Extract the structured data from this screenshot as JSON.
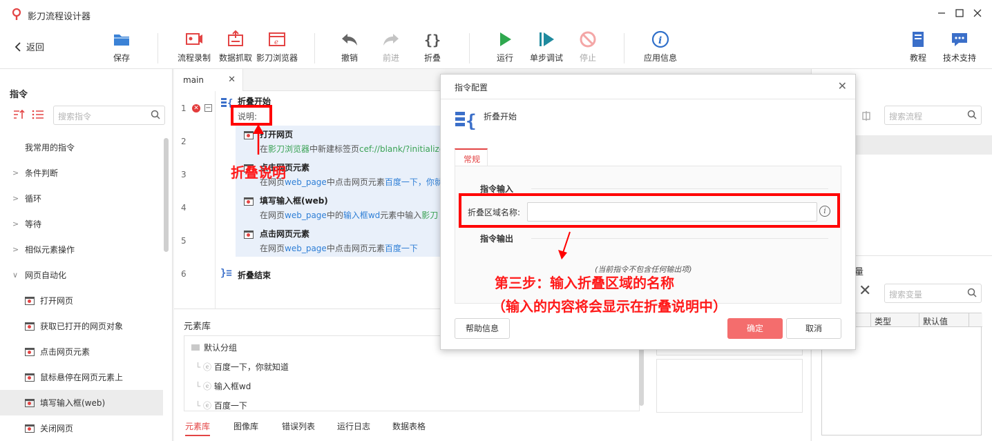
{
  "app": {
    "title": "影刀流程设计器"
  },
  "toolbar": {
    "back": "返回",
    "save": "保存",
    "record": "流程录制",
    "scrape": "数据抓取",
    "browser": "影刀浏览器",
    "undo": "撤销",
    "redo": "前进",
    "fold": "折叠",
    "run": "运行",
    "step_debug": "单步调试",
    "stop": "停止",
    "app_info": "应用信息",
    "tutorial": "教程",
    "support": "技术支持"
  },
  "left_panel": {
    "title": "指令",
    "search_placeholder": "搜索指令",
    "items": [
      {
        "label": "我常用的指令",
        "kind": "plain"
      },
      {
        "label": "条件判断",
        "kind": "group"
      },
      {
        "label": "循环",
        "kind": "group"
      },
      {
        "label": "等待",
        "kind": "group"
      },
      {
        "label": "相似元素操作",
        "kind": "group"
      },
      {
        "label": "网页自动化",
        "kind": "group-open"
      },
      {
        "label": "打开网页",
        "kind": "sub"
      },
      {
        "label": "获取已打开的网页对象",
        "kind": "sub"
      },
      {
        "label": "点击网页元素",
        "kind": "sub"
      },
      {
        "label": "鼠标悬停在网页元素上",
        "kind": "sub"
      },
      {
        "label": "填写输入框(web)",
        "kind": "sub-selected"
      },
      {
        "label": "关闭网页",
        "kind": "sub"
      }
    ]
  },
  "editor": {
    "tab": "main",
    "line_numbers": [
      "1",
      "2",
      "3",
      "4",
      "5",
      "6"
    ],
    "fold_start": "折叠开始",
    "note_label": "说明:",
    "fold_end": "折叠结束",
    "cmds": [
      {
        "title": "打开网页",
        "desc_parts": [
          "在",
          "影刀浏览器",
          "中新建标签页",
          "cef://blank/?initialize"
        ]
      },
      {
        "title": "点击网页元素",
        "desc_parts": [
          "在网页",
          "web_page",
          "中点击网页元素",
          "百度一下，你就"
        ]
      },
      {
        "title": "填写输入框(web)",
        "desc_parts": [
          "在网页",
          "web_page",
          "中的",
          "输入框wd",
          "元素中输入",
          "影刀"
        ]
      },
      {
        "title": "点击网页元素",
        "desc_parts": [
          "在网页",
          "web_page",
          "中点击网页元素",
          "百度一下"
        ]
      }
    ]
  },
  "element_library": {
    "title": "元素库",
    "group": "默认分组",
    "items": [
      "百度一下，你就知道",
      "输入框wd",
      "百度一下"
    ]
  },
  "bottom_tabs": [
    "元素库",
    "图像库",
    "错误列表",
    "运行日志",
    "数据表格"
  ],
  "right_panel": {
    "search_flow_placeholder": "搜索流程",
    "var_title_partial": "量",
    "search_var_placeholder": "搜索变量",
    "columns": [
      "类型",
      "默认值"
    ]
  },
  "dialog": {
    "title": "指令配置",
    "subtitle": "折叠开始",
    "tab": "常规",
    "input_section": "指令输入",
    "field_label": "折叠区域名称:",
    "field_value": "",
    "output_section": "指令输出",
    "no_output": "(当前指令不包含任何输出项)",
    "help": "帮助信息",
    "ok": "确定",
    "cancel": "取消"
  },
  "annotations": {
    "fold_note": "折叠说明",
    "step3": "第三步：输入折叠区域的名称",
    "step3_sub": "（输入的内容将会显示在折叠说明中）"
  },
  "colors": {
    "accent_red": "#e34444",
    "annotation_red": "#ff0000",
    "primary_button": "#f46d6d",
    "link_blue": "#2f7fd6",
    "link_green": "#3aa255"
  }
}
